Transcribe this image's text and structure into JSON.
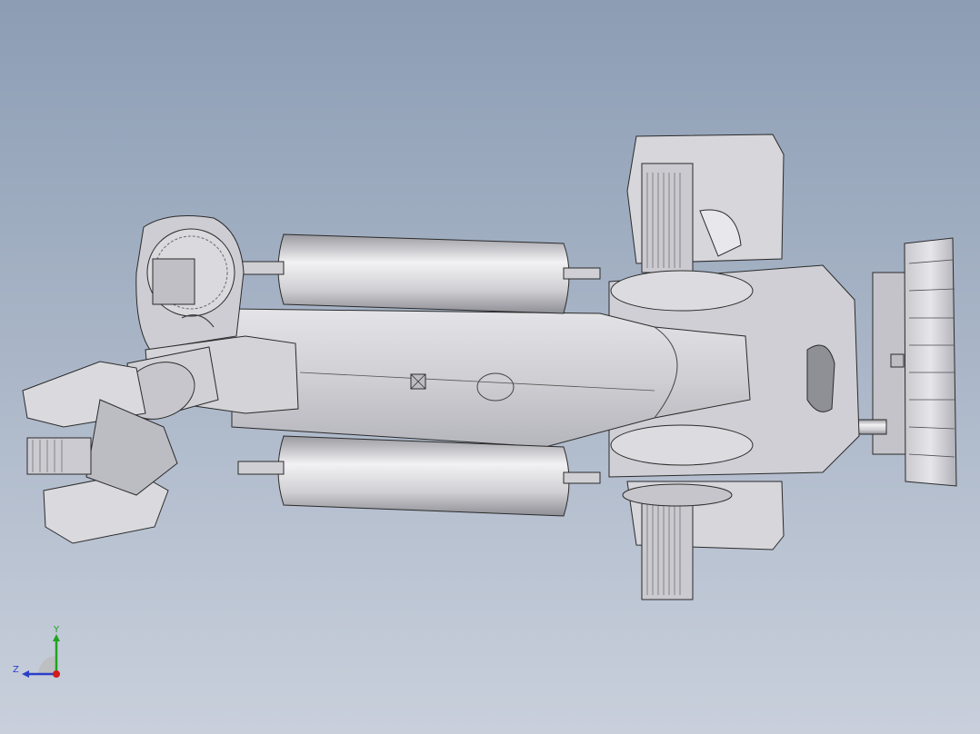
{
  "viewport": {
    "background_top": "#8c9db4",
    "background_bottom": "#c9d0dc",
    "part_fill": "#d4d4d8",
    "part_shade": "#a9a9b0",
    "edge_color": "#2b2b2b"
  },
  "triad": {
    "y_label": "Y",
    "z_label": "Z",
    "y_color": "#1fa31f",
    "z_color": "#2a3fc8",
    "x_color": "#d41a1a"
  }
}
